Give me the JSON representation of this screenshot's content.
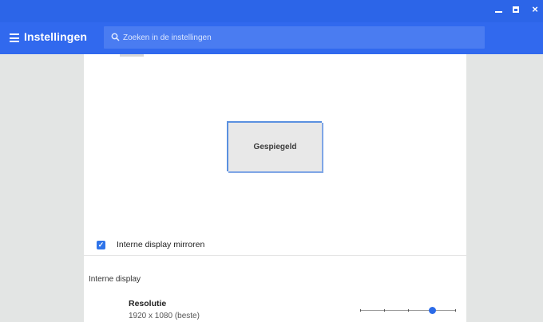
{
  "window": {
    "minimize_icon": "minimize-icon",
    "maximize_icon": "maximize-icon",
    "close_label": "×"
  },
  "appbar": {
    "title": "Instellingen",
    "menu_icon": "hamburger-menu-icon"
  },
  "search": {
    "placeholder": "Zoeken in de instellingen",
    "value": "",
    "icon": "search-icon"
  },
  "display": {
    "arrangement_label": "Gespiegeld",
    "mirror": {
      "checked": true,
      "check_mark": "✓",
      "label": "Interne display mirroren"
    },
    "section_title": "Interne display",
    "resolution": {
      "title": "Resolutie",
      "value": "1920 x 1080 (beste)",
      "slider_level": 0.75
    }
  },
  "colors": {
    "titlebar": "#2c65e8",
    "appbar": "#3169ee",
    "accent": "#2f74e9"
  }
}
